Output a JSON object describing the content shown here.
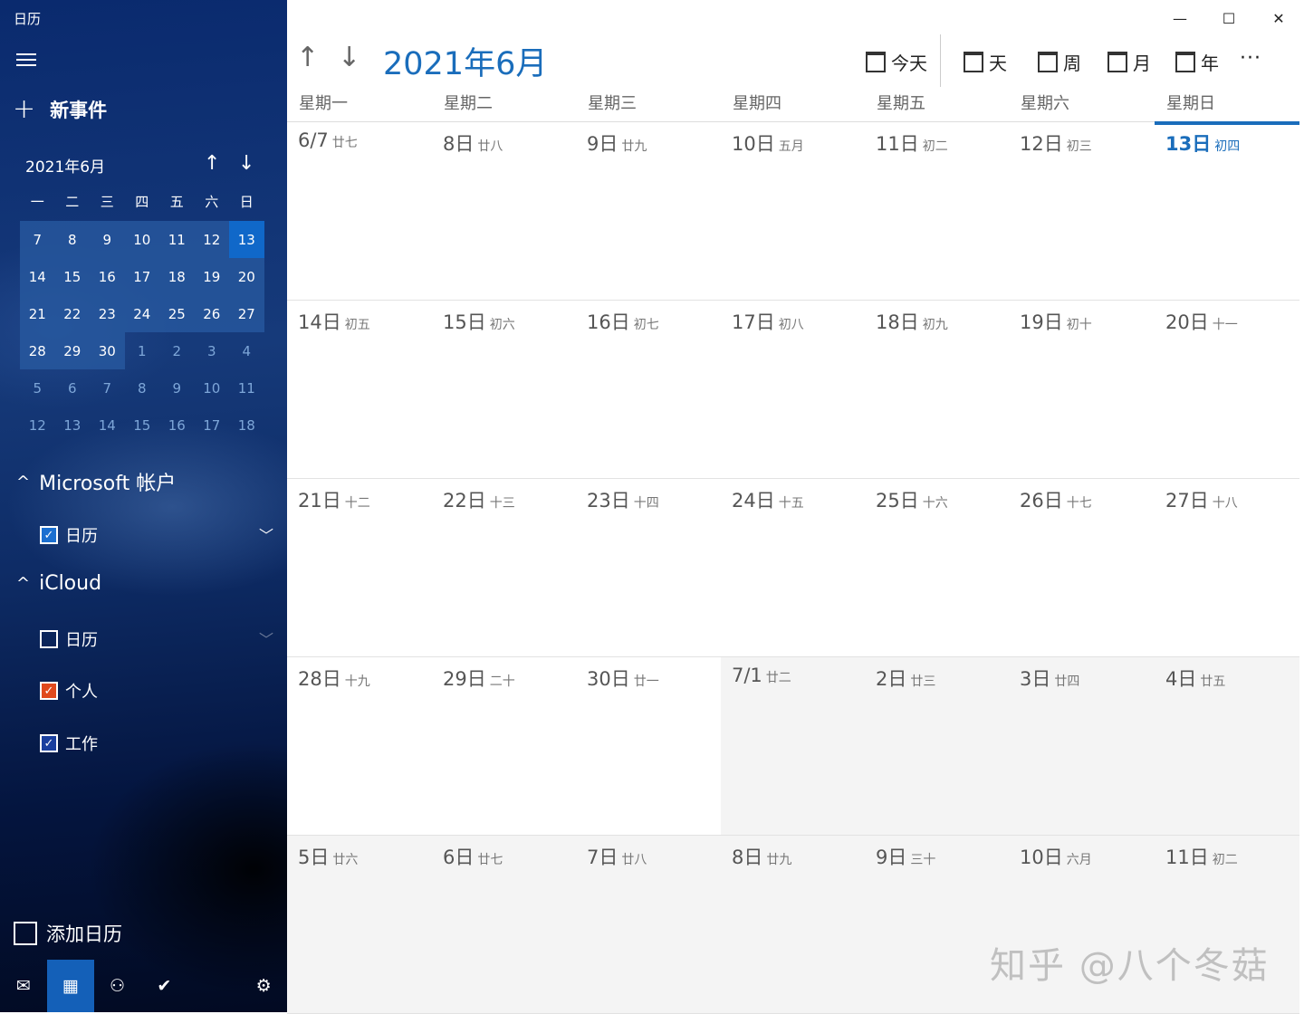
{
  "app": {
    "title": "日历"
  },
  "sidebar": {
    "new_event": "新事件",
    "mini_calendar": {
      "title": "2021年6月",
      "weekday_headers": [
        "一",
        "二",
        "三",
        "四",
        "五",
        "六",
        "日"
      ],
      "weeks": [
        [
          "7",
          "8",
          "9",
          "10",
          "11",
          "12",
          "13"
        ],
        [
          "14",
          "15",
          "16",
          "17",
          "18",
          "19",
          "20"
        ],
        [
          "21",
          "22",
          "23",
          "24",
          "25",
          "26",
          "27"
        ],
        [
          "28",
          "29",
          "30",
          "1",
          "2",
          "3",
          "4"
        ],
        [
          "5",
          "6",
          "7",
          "8",
          "9",
          "10",
          "11"
        ],
        [
          "12",
          "13",
          "14",
          "15",
          "16",
          "17",
          "18"
        ]
      ]
    },
    "accounts": [
      {
        "name": "Microsoft 帐户",
        "calendars": [
          {
            "label": "日历",
            "checked": true,
            "color": "#1b6fd0"
          }
        ]
      },
      {
        "name": "iCloud",
        "calendars": [
          {
            "label": "日历",
            "checked": false,
            "color": "#ffffff"
          },
          {
            "label": "个人",
            "checked": true,
            "color": "#e0491d"
          },
          {
            "label": "工作",
            "checked": true,
            "color": "#1a3f9e"
          }
        ]
      }
    ],
    "add_calendar": "添加日历",
    "bottom_nav": [
      "mail-icon",
      "calendar-icon",
      "people-icon",
      "todo-icon",
      "settings-icon"
    ]
  },
  "toolbar": {
    "month_title": "2021年6月",
    "today": "今天",
    "views": [
      "天",
      "周",
      "月",
      "年"
    ],
    "more": "···"
  },
  "weekdays": [
    "星期一",
    "星期二",
    "星期三",
    "星期四",
    "星期五",
    "星期六",
    "星期日"
  ],
  "weeks": [
    [
      {
        "d": "6/7",
        "l": "廿七"
      },
      {
        "d": "8日",
        "l": "廿八"
      },
      {
        "d": "9日",
        "l": "廿九"
      },
      {
        "d": "10日",
        "l": "五月"
      },
      {
        "d": "11日",
        "l": "初二"
      },
      {
        "d": "12日",
        "l": "初三"
      },
      {
        "d": "13日",
        "l": "初四",
        "today": true
      }
    ],
    [
      {
        "d": "14日",
        "l": "初五"
      },
      {
        "d": "15日",
        "l": "初六"
      },
      {
        "d": "16日",
        "l": "初七"
      },
      {
        "d": "17日",
        "l": "初八"
      },
      {
        "d": "18日",
        "l": "初九"
      },
      {
        "d": "19日",
        "l": "初十"
      },
      {
        "d": "20日",
        "l": "十一"
      }
    ],
    [
      {
        "d": "21日",
        "l": "十二"
      },
      {
        "d": "22日",
        "l": "十三"
      },
      {
        "d": "23日",
        "l": "十四"
      },
      {
        "d": "24日",
        "l": "十五"
      },
      {
        "d": "25日",
        "l": "十六"
      },
      {
        "d": "26日",
        "l": "十七"
      },
      {
        "d": "27日",
        "l": "十八"
      }
    ],
    [
      {
        "d": "28日",
        "l": "十九"
      },
      {
        "d": "29日",
        "l": "二十"
      },
      {
        "d": "30日",
        "l": "廿一"
      },
      {
        "d": "7/1",
        "l": "廿二",
        "other": true
      },
      {
        "d": "2日",
        "l": "廿三",
        "other": true
      },
      {
        "d": "3日",
        "l": "廿四",
        "other": true
      },
      {
        "d": "4日",
        "l": "廿五",
        "other": true
      }
    ],
    [
      {
        "d": "5日",
        "l": "廿六",
        "other": true
      },
      {
        "d": "6日",
        "l": "廿七",
        "other": true
      },
      {
        "d": "7日",
        "l": "廿八",
        "other": true
      },
      {
        "d": "8日",
        "l": "廿九",
        "other": true
      },
      {
        "d": "9日",
        "l": "三十",
        "other": true
      },
      {
        "d": "10日",
        "l": "六月",
        "other": true
      },
      {
        "d": "11日",
        "l": "初二",
        "other": true
      }
    ]
  ],
  "watermark": "知乎 @八个冬菇"
}
